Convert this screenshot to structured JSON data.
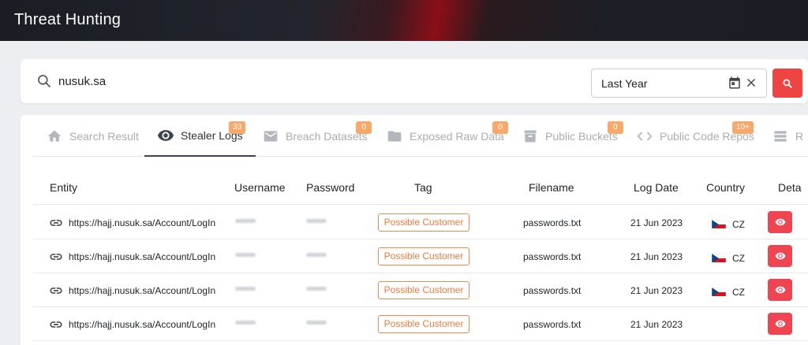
{
  "app": {
    "title": "Threat Hunting"
  },
  "search": {
    "query": "nusuk.sa",
    "date_range": "Last Year"
  },
  "tabs": [
    {
      "label": "Search Result",
      "icon": "home-icon",
      "badge": ""
    },
    {
      "label": "Stealer Logs",
      "icon": "eye-icon",
      "badge": "33",
      "active": true
    },
    {
      "label": "Breach Datasets",
      "icon": "mail-icon",
      "badge": "0"
    },
    {
      "label": "Exposed Raw Data",
      "icon": "folder-icon",
      "badge": "0"
    },
    {
      "label": "Public Buckets",
      "icon": "archive-icon",
      "badge": "0"
    },
    {
      "label": "Public Code Repos",
      "icon": "code-icon",
      "badge": "10+"
    },
    {
      "label": "R",
      "icon": "list-icon",
      "badge": ""
    }
  ],
  "table": {
    "columns": [
      "Entity",
      "Username",
      "Password",
      "Tag",
      "Filename",
      "Log Date",
      "Country",
      "Deta"
    ],
    "rows": [
      {
        "entity": "https://hajj.nusuk.sa/Account/LogIn",
        "tag": "Possible Customer",
        "filename": "passwords.txt",
        "log_date": "21 Jun 2023",
        "country": "CZ"
      },
      {
        "entity": "https://hajj.nusuk.sa/Account/LogIn",
        "tag": "Possible Customer",
        "filename": "passwords.txt",
        "log_date": "21 Jun 2023",
        "country": "CZ"
      },
      {
        "entity": "https://hajj.nusuk.sa/Account/LogIn",
        "tag": "Possible Customer",
        "filename": "passwords.txt",
        "log_date": "21 Jun 2023",
        "country": "CZ"
      },
      {
        "entity": "https://hajj.nusuk.sa/Account/LogIn",
        "tag": "Possible Customer",
        "filename": "passwords.txt",
        "log_date": "21 Jun 2023",
        "country": ""
      }
    ]
  },
  "colors": {
    "accent_red": "#ef4444",
    "badge_orange": "#f5a96b",
    "tag_orange": "#f07a3d"
  }
}
